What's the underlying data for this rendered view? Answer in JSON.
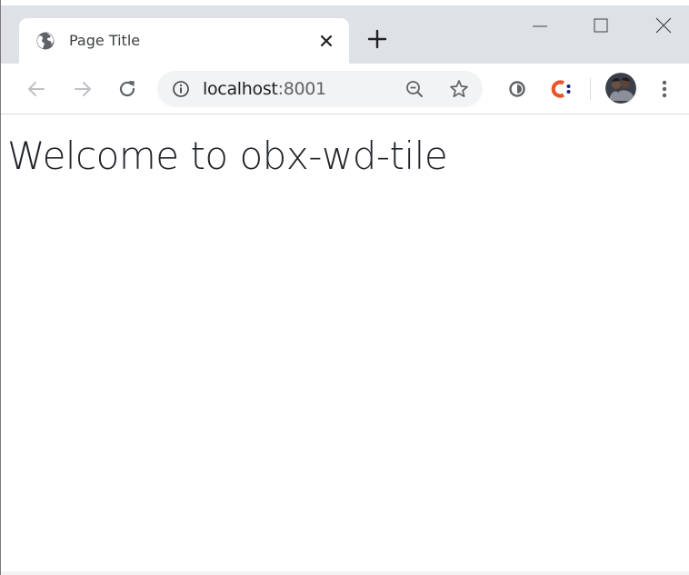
{
  "browser": {
    "tab": {
      "title": "Page Title",
      "favicon": "globe-icon",
      "close_glyph": "✕"
    },
    "new_tab_icon": "plus-icon",
    "window_controls": [
      "minimize-icon",
      "maximize-icon",
      "close-icon"
    ],
    "address_bar": {
      "host": "localhost",
      "port": ":8001",
      "leading_icon": "info-icon",
      "trailing_icons": [
        "zoom-out-icon",
        "star-icon"
      ]
    },
    "extensions": [
      "circle-extension-icon",
      "c-extension-icon"
    ],
    "profile": "avatar",
    "menu_icon": "kebab-menu-icon"
  },
  "page": {
    "heading": "Welcome to obx-wd-tile"
  },
  "colors": {
    "tabstrip": "#dee1e6",
    "omnibox": "#f1f3f4",
    "c_extension": "#e8552a",
    "text": "#212529"
  }
}
